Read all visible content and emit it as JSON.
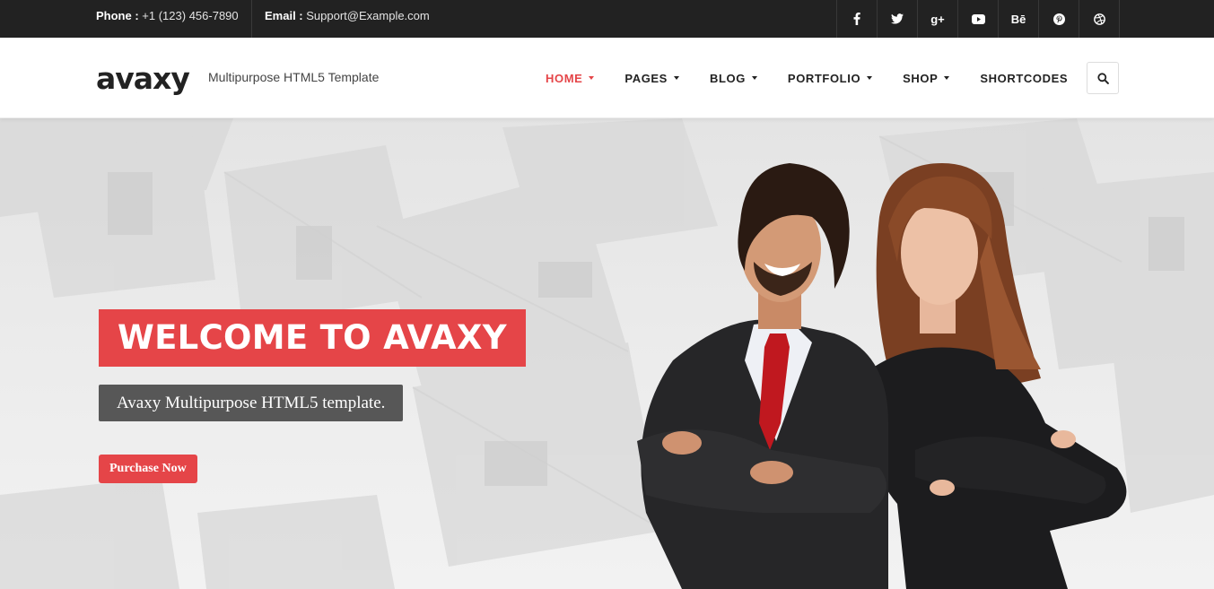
{
  "topbar": {
    "phone_label": "Phone :",
    "phone_value": "+1 (123) 456-7890",
    "email_label": "Email :",
    "email_value": "Support@Example.com",
    "socials": [
      "facebook-icon",
      "twitter-icon",
      "google-plus-icon",
      "youtube-icon",
      "behance-icon",
      "pinterest-icon",
      "dribbble-icon"
    ],
    "behance_text": "Bē",
    "google_text": "g+"
  },
  "header": {
    "logo": "avaxy",
    "tagline": "Multipurpose HTML5 Template",
    "nav": [
      {
        "label": "HOME"
      },
      {
        "label": "PAGES"
      },
      {
        "label": "BLOG"
      },
      {
        "label": "PORTFOLIO"
      },
      {
        "label": "SHOP"
      },
      {
        "label": "SHORTCODES"
      }
    ],
    "active_color": "#e54548"
  },
  "hero": {
    "title": "WELCOME TO AVAXY",
    "subtitle": "Avaxy Multipurpose HTML5 template.",
    "button": "Purchase Now",
    "accent": "#e54548"
  }
}
